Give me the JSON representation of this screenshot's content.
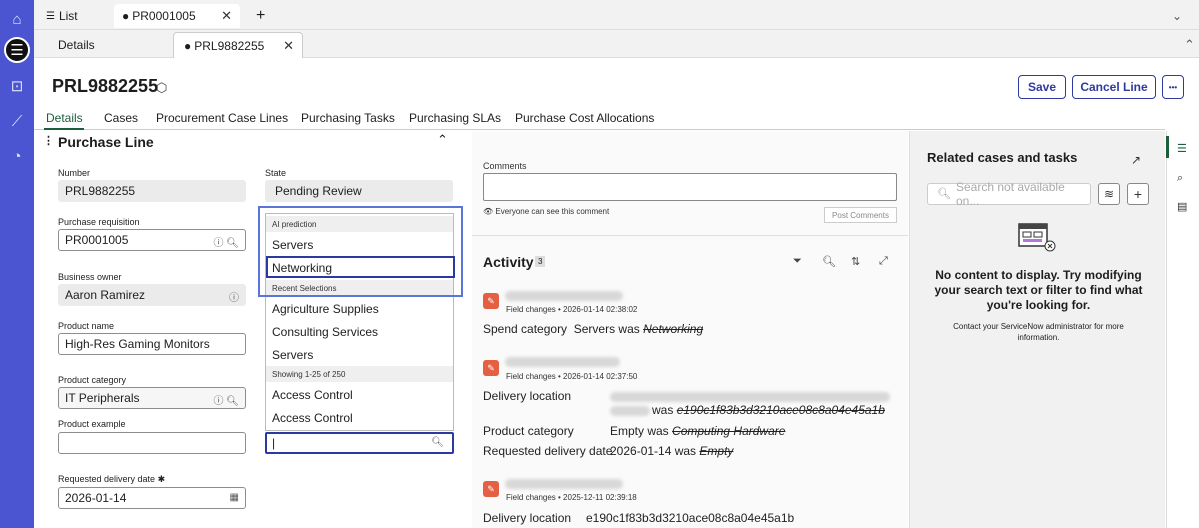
{
  "rail": {
    "icons": [
      "home-icon",
      "list-icon",
      "inbox-icon",
      "chart-icon",
      "dashboard-icon"
    ]
  },
  "window_tabs": [
    {
      "label": "List"
    },
    {
      "label": "PR0001005"
    }
  ],
  "sub_tabs": [
    {
      "label": "Details"
    },
    {
      "label": "PRL9882255"
    }
  ],
  "record": {
    "title": "PRL9882255",
    "save_label": "Save",
    "cancel_line_label": "Cancel Line",
    "more_label": "•••"
  },
  "form_tabs": [
    "Details",
    "Cases",
    "Procurement Case Lines",
    "Purchasing Tasks",
    "Purchasing SLAs",
    "Purchase Cost Allocations"
  ],
  "section": {
    "title": "Purchase Line"
  },
  "fields": {
    "number": {
      "label": "Number",
      "value": "PRL9882255"
    },
    "state": {
      "label": "State",
      "value": "Pending Review"
    },
    "purchase_requisition": {
      "label": "Purchase requisition",
      "value": "PR0001005"
    },
    "business_owner": {
      "label": "Business owner",
      "value": "Aaron Ramirez"
    },
    "product_name": {
      "label": "Product name",
      "value": "High-Res Gaming Monitors"
    },
    "product_category": {
      "label": "Product category",
      "value": "IT Peripherals"
    },
    "product_example": {
      "label": "Product example",
      "value": ""
    },
    "requested_delivery_date": {
      "label": "Requested delivery date",
      "required_mark": "✱",
      "value": "2026-01-14"
    }
  },
  "dropdown": {
    "ai_header": "AI prediction",
    "ai_items": [
      "Servers",
      "Networking"
    ],
    "recent_header": "Recent Selections",
    "recent_items": [
      "Agriculture Supplies",
      "Consulting Services",
      "Servers"
    ],
    "showing_header": "Showing 1-25 of 250",
    "list_items": [
      "Access Control",
      "Access Control"
    ],
    "search_value": ""
  },
  "comments": {
    "label": "Comments",
    "visibility_note": "Everyone can see this comment",
    "post_label": "Post Comments"
  },
  "activity": {
    "title": "Activity",
    "count": "3",
    "entries": [
      {
        "meta": "Field changes • 2026-01-14 02:38:02",
        "lines": [
          {
            "field": "Spend category",
            "new": "Servers was",
            "old": "Networking"
          }
        ]
      },
      {
        "meta": "Field changes • 2026-01-14 02:37:50",
        "lines": [
          {
            "field": "Delivery location",
            "new": "was",
            "old": "e190c1f83b3d3210ace08c8a04e45a1b"
          },
          {
            "field": "Product category",
            "new": "Empty was",
            "old": "Computing Hardware"
          },
          {
            "field": "Requested delivery date",
            "new": "2026-01-14 was",
            "old": "Empty"
          }
        ]
      },
      {
        "meta": "Field changes • 2025-12-11 02:39:18",
        "lines": [
          {
            "field": "Delivery location",
            "new": "e190c1f83b3d3210ace08c8a04e45a1b",
            "old": ""
          }
        ]
      }
    ]
  },
  "related": {
    "title": "Related cases and tasks",
    "search_placeholder": "Search not available on...",
    "no_content": "No content to display. Try modifying your search text or filter to find what you're looking for.",
    "contact": "Contact your ServiceNow administrator for more information."
  },
  "colors": {
    "rail": "#4b55d1",
    "accent_blue": "#2e3a9e",
    "active_tab_green": "#1a5e3a",
    "activity_pencil": "#e55f43"
  }
}
